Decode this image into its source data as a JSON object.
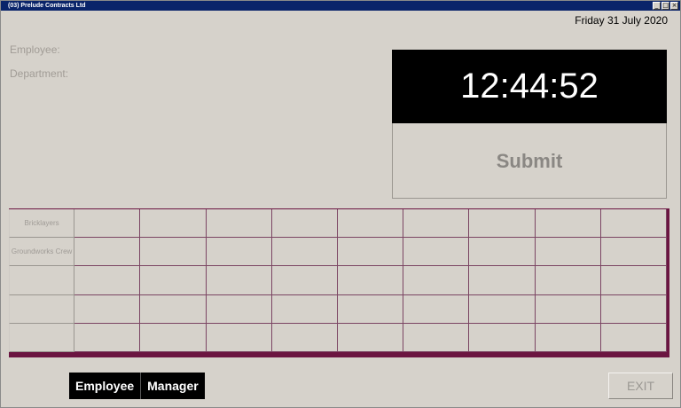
{
  "window": {
    "title": "(03) Prelude Contracts Ltd",
    "controls": [
      "minimize",
      "maximize",
      "close"
    ]
  },
  "header": {
    "date": "Friday 31 July 2020"
  },
  "info": {
    "employee_label": "Employee:",
    "department_label": "Department:"
  },
  "clock": {
    "time": "12:44:52"
  },
  "actions": {
    "submit_label": "Submit",
    "exit_label": "EXIT"
  },
  "departments": [
    {
      "label": "Bricklayers"
    },
    {
      "label": "Groundworks Crew"
    },
    {
      "label": ""
    },
    {
      "label": ""
    },
    {
      "label": ""
    }
  ],
  "mode": {
    "employee_label": "Employee",
    "manager_label": "Manager"
  }
}
